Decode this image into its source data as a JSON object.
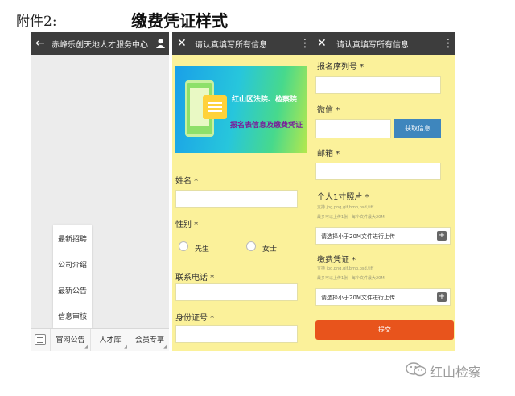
{
  "document": {
    "attachment_label": "附件2:",
    "title": "缴费凭证样式"
  },
  "screen_menu": {
    "title": "赤峰乐创天地人才服务中心",
    "menu_items": [
      "最新招聘",
      "公司介绍",
      "最新公告",
      "信息审核"
    ],
    "bottom_tabs": [
      "官网公告",
      "人才库",
      "会员专享"
    ]
  },
  "screen_form1": {
    "title": "请认真填写所有信息",
    "banner_line1": "红山区法院、检察院",
    "banner_line2": "报名表信息及缴费凭证",
    "fields": {
      "name_label": "姓名 *",
      "gender_label": "性别 *",
      "gender_options": [
        "先生",
        "女士"
      ],
      "phone_label": "联系电话 *",
      "id_label": "身份证号 *"
    }
  },
  "screen_form2": {
    "title": "请认真填写所有信息",
    "serial_label": "报名序列号 *",
    "wechat_label": "微信 *",
    "wechat_button": "获取信息",
    "email_label": "邮箱 *",
    "photo_label": "个人1寸照片 *",
    "photo_hint1": "支持 jpg,png,gif,bmp,psd,tiff",
    "photo_hint2": "最多可以上传1张 · 每个文件最大20M",
    "photo_upload": "请选择小于20M文件进行上传",
    "payment_label": "缴费凭证 *",
    "payment_hint1": "支持 jpg,png,gif,bmp,psd,tiff",
    "payment_hint2": "最多可以上传1张 · 每个文件最大20M",
    "payment_upload": "请选择小于20M文件进行上传",
    "submit": "提交"
  },
  "watermark": {
    "text": "红山检察"
  },
  "icons": {
    "back": "arrow-left-icon",
    "user": "person-icon",
    "close": "close-icon",
    "more": "more-vertical-icon",
    "keyboard": "keyboard-icon",
    "plus": "plus-icon",
    "wechat_logo": "wechat-logo-icon"
  },
  "colors": {
    "appbar": "#3d3d3d",
    "form_background": "#fbf19a",
    "wechat_button": "#3e86bd",
    "submit_button": "#e8541c",
    "banner_text_primary": "#ffffff",
    "banner_text_secondary": "#7a1f9a"
  }
}
